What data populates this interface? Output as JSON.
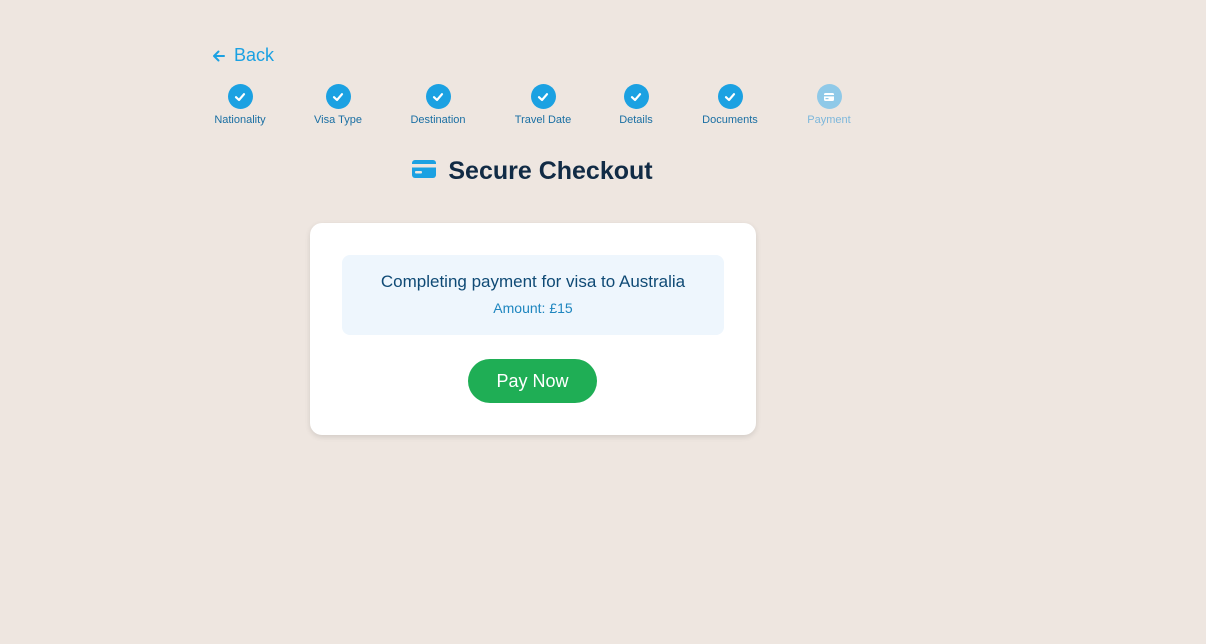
{
  "nav": {
    "back_label": "Back",
    "back_icon": "arrow-left-icon"
  },
  "stepper": {
    "steps": [
      {
        "label": "Nationality",
        "status": "complete",
        "icon": "check-icon"
      },
      {
        "label": "Visa Type",
        "status": "complete",
        "icon": "check-icon"
      },
      {
        "label": "Destination",
        "status": "complete",
        "icon": "check-icon"
      },
      {
        "label": "Travel Date",
        "status": "complete",
        "icon": "check-icon"
      },
      {
        "label": "Details",
        "status": "complete",
        "icon": "check-icon"
      },
      {
        "label": "Documents",
        "status": "complete",
        "icon": "check-icon"
      },
      {
        "label": "Payment",
        "status": "current",
        "icon": "credit-card-icon"
      }
    ]
  },
  "checkout": {
    "title": "Secure Checkout",
    "title_icon": "credit-card-icon",
    "summary_text": "Completing payment for visa to Australia",
    "amount_text": "Amount: £15",
    "pay_button_label": "Pay Now"
  },
  "colors": {
    "background": "#EEE6E0",
    "accent": "#1BA1E2",
    "pay_button": "#1FAE55",
    "heading": "#112B45"
  }
}
